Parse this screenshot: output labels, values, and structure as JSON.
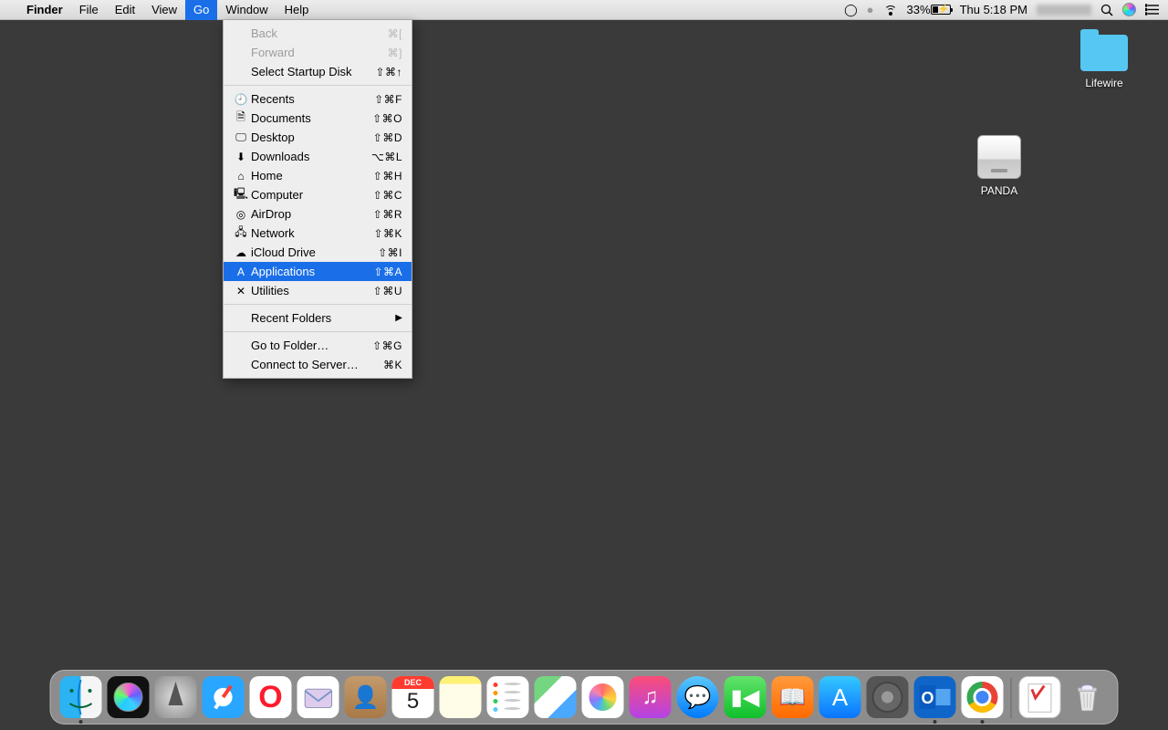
{
  "menubar": {
    "app": "Finder",
    "items": [
      "File",
      "Edit",
      "View",
      "Go",
      "Window",
      "Help"
    ],
    "active": "Go",
    "status": {
      "battery_pct": "33%",
      "clock": "Thu 5:18 PM"
    }
  },
  "dropdown": {
    "groups": [
      [
        {
          "label": "Back",
          "shortcut": "⌘[",
          "disabled": true
        },
        {
          "label": "Forward",
          "shortcut": "⌘]",
          "disabled": true
        },
        {
          "label": "Select Startup Disk",
          "shortcut": "⇧⌘↑"
        }
      ],
      [
        {
          "icon": "clock-icon",
          "label": "Recents",
          "shortcut": "⇧⌘F"
        },
        {
          "icon": "document-icon",
          "label": "Documents",
          "shortcut": "⇧⌘O"
        },
        {
          "icon": "desktop-icon",
          "label": "Desktop",
          "shortcut": "⇧⌘D"
        },
        {
          "icon": "download-icon",
          "label": "Downloads",
          "shortcut": "⌥⌘L"
        },
        {
          "icon": "home-icon",
          "label": "Home",
          "shortcut": "⇧⌘H"
        },
        {
          "icon": "computer-icon",
          "label": "Computer",
          "shortcut": "⇧⌘C"
        },
        {
          "icon": "airdrop-icon",
          "label": "AirDrop",
          "shortcut": "⇧⌘R"
        },
        {
          "icon": "network-icon",
          "label": "Network",
          "shortcut": "⇧⌘K"
        },
        {
          "icon": "cloud-icon",
          "label": "iCloud Drive",
          "shortcut": "⇧⌘I"
        },
        {
          "icon": "applications-icon",
          "label": "Applications",
          "shortcut": "⇧⌘A",
          "highlight": true
        },
        {
          "icon": "utilities-icon",
          "label": "Utilities",
          "shortcut": "⇧⌘U"
        }
      ],
      [
        {
          "label": "Recent Folders",
          "submenu": true
        }
      ],
      [
        {
          "label": "Go to Folder…",
          "shortcut": "⇧⌘G"
        },
        {
          "label": "Connect to Server…",
          "shortcut": "⌘K"
        }
      ]
    ]
  },
  "desktop": {
    "folder_label": "Lifewire",
    "drive_label": "PANDA"
  },
  "dock": {
    "cal_month": "DEC",
    "cal_day": "5",
    "opera_glyph": "O",
    "music_glyph": "♫",
    "msg_glyph": "💬",
    "ft_glyph": "📹",
    "books_glyph": "📖",
    "outlook_glyph": "O⃞",
    "trash_full": true
  }
}
